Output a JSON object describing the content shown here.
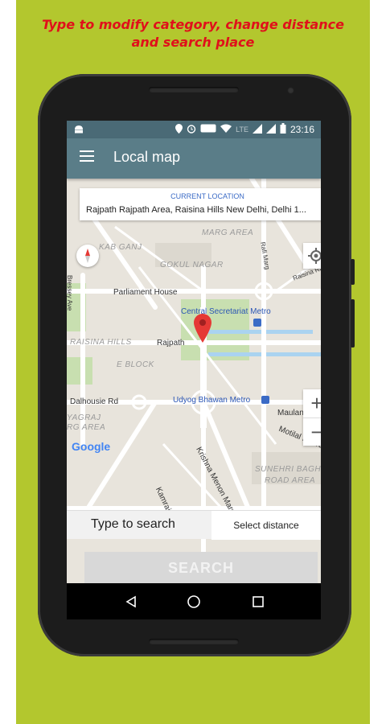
{
  "promo": {
    "caption_line1": "Type to modify category, change distance",
    "caption_line2": "and search place",
    "bg_color": "#b3c72e",
    "caption_color": "#e0101b"
  },
  "status_bar": {
    "time": "23:16",
    "network": "LTE",
    "icons": [
      "android-icon",
      "location-icon",
      "alarm-icon",
      "volte-icon",
      "wifi-icon",
      "signal-icon",
      "battery-icon"
    ]
  },
  "app_bar": {
    "title": "Local map",
    "color": "#5a7d88"
  },
  "location": {
    "label": "CURRENT LOCATION",
    "value": "Rajpath Rajpath Area, Raisina Hills New Delhi, Delhi 1..."
  },
  "map": {
    "labels": {
      "kab_ganj": "KAB GANJ",
      "marg_area": "MARG AREA",
      "gokul_nagar": "GOKUL NAGAR",
      "parliament": "Parliament House",
      "central_metro": "Central Secretariat Metro",
      "raisina_hills": "RAISINA HILLS",
      "rajpath": "Rajpath",
      "e_block": "E BLOCK",
      "dalhousie": "Dalhousie Rd",
      "udyog": "Udyog Bhawan Metro",
      "maulana": "Maulana Azad Rd",
      "motilal": "Motilal Nehru Marg",
      "agraj": "YAGRAJ",
      "rg_area": "RG AREA",
      "sunehri": "SUNEHRI BAGH",
      "road_area": "ROAD AREA",
      "krishna": "Krishna Menon Marg",
      "bressey": "Bressey Ave",
      "raisina_rd": "Raisina Rd",
      "rafi": "Rafi Marg",
      "kamraj": "Kamraj"
    },
    "google_logo": "Google",
    "zoom_in": "+",
    "zoom_out": "−"
  },
  "search": {
    "placeholder": "Type to search",
    "distance_label": "Select distance",
    "button_label": "SEARCH"
  },
  "nav_icons": [
    "back-icon",
    "home-icon",
    "recents-icon"
  ]
}
